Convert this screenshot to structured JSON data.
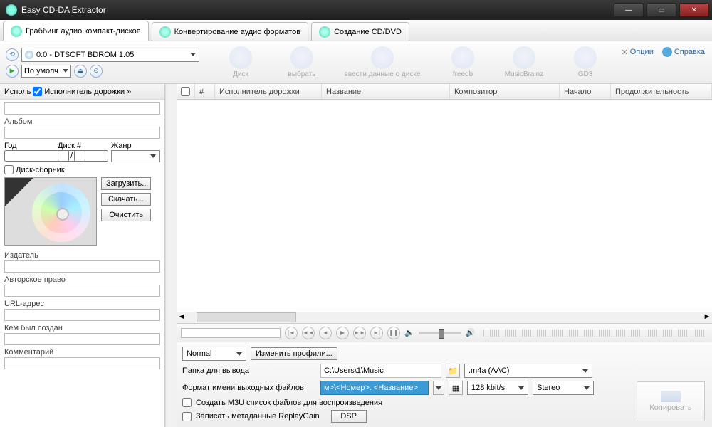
{
  "window": {
    "title": "Easy CD-DA Extractor"
  },
  "tabs": [
    {
      "label": "Граббинг аудио компакт-дисков"
    },
    {
      "label": "Конвертирование аудио форматов"
    },
    {
      "label": "Создание CD/DVD"
    }
  ],
  "toolbar": {
    "drive": "0:0 - DTSOFT BDROM 1.05",
    "profile": "По умолч",
    "buttons": [
      {
        "label": "Диск"
      },
      {
        "label": "выбрать"
      },
      {
        "label": "ввести данные о диске"
      },
      {
        "label": "freedb"
      },
      {
        "label": "MusicBrainz"
      },
      {
        "label": "GD3"
      }
    ],
    "options": "Опции",
    "help": "Справка"
  },
  "left": {
    "header": {
      "artist": "Исполь",
      "track_artist": "Исполнитель дорожки »"
    },
    "album": "Альбом",
    "year": "Год",
    "disc_no": "Диск #",
    "genre": "Жанр",
    "compilation": "Диск-сборник",
    "load": "Загрузить..",
    "download": "Скачать...",
    "clear": "Очистить",
    "publisher": "Издатель",
    "copyright": "Авторское право",
    "url": "URL-адрес",
    "encoded": "Кем был создан",
    "comment": "Комментарий"
  },
  "columns": {
    "num": "#",
    "artist": "Исполнитель дорожки",
    "title": "Название",
    "composer": "Композитор",
    "start": "Начало",
    "duration": "Продолжительность"
  },
  "bottom": {
    "profile_sel": "Normal",
    "change_profile": "Изменить профили...",
    "output_folder_lbl": "Папка для вывода",
    "output_folder": "C:\\Users\\1\\Music",
    "filename_fmt_lbl": "Формат имени выходных файлов",
    "filename_fmt": "м>\\<Номер>. <Название>",
    "format": ".m4a (AAC)",
    "bitrate": "128 kbit/s",
    "channels": "Stereo",
    "m3u": "Создать M3U список файлов для воспроизведения",
    "replaygain": "Записать метаданные ReplayGain",
    "dsp": "DSP",
    "copy": "Копировать"
  }
}
